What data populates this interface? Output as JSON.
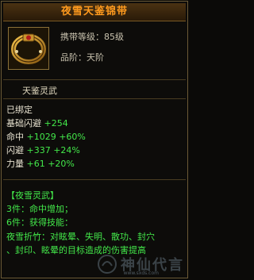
{
  "tooltip": {
    "title": "夜雪天鉴锦带",
    "carry_level": "携带等级：85级",
    "grade": "品阶：天阶",
    "item_label": "天鉴灵武",
    "bind_status": "已绑定",
    "stats": [
      {
        "label": "基础闪避",
        "value": "+254",
        "bonus": ""
      },
      {
        "label": "命中",
        "value": "+1029",
        "bonus": "+60%"
      },
      {
        "label": "闪避",
        "value": "+337",
        "bonus": "+24%"
      },
      {
        "label": "力量",
        "value": "+61",
        "bonus": "+20%"
      }
    ],
    "set": {
      "name": "【夜雪灵武】",
      "piece3": "3件：命中增加；",
      "piece6": "6件：获得技能：",
      "skill_line1": "夜雪折竹：对眩晕、失明、散功、封穴",
      "skill_line2": "、封印、眩晕的目标造成的伤害提高"
    }
  },
  "watermark": {
    "text": "神仙代言",
    "url": "www.sxds.com"
  },
  "colors": {
    "title": "#ff9a1e",
    "green": "#43e84a",
    "blue": "#7fb4ff"
  }
}
